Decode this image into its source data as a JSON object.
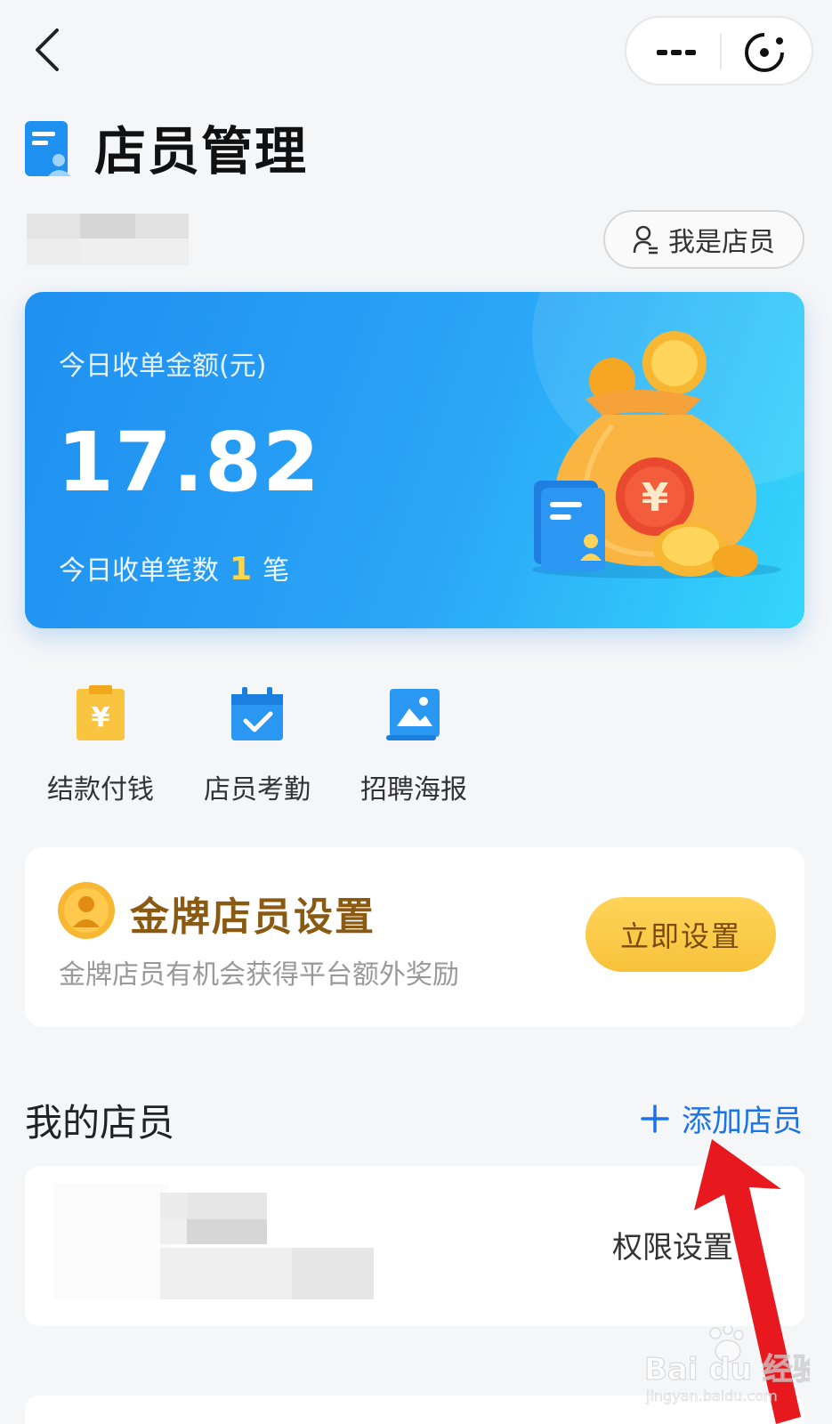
{
  "header": {
    "back_icon": "chevron-left-icon",
    "more_icon": "more-dots-icon",
    "close_icon": "mini-program-close-icon"
  },
  "page": {
    "title": "店员管理",
    "role_button": "我是店员"
  },
  "summary_card": {
    "amount_label": "今日收单金额(元)",
    "amount": "17.82",
    "count_prefix": "今日收单笔数",
    "count": "1",
    "count_suffix": "笔"
  },
  "quick_actions": [
    {
      "label": "结款付钱",
      "icon": "payment-yuan-icon"
    },
    {
      "label": "店员考勤",
      "icon": "calendar-check-icon"
    },
    {
      "label": "招聘海报",
      "icon": "poster-image-icon"
    }
  ],
  "gold_staff": {
    "title": "金牌店员设置",
    "subtitle": "金牌店员有机会获得平台额外奖励",
    "button": "立即设置"
  },
  "my_staff": {
    "title": "我的店员",
    "add_button": "添加店员",
    "permission_label": "权限设置"
  },
  "watermark": {
    "brand": "Bai du 经验",
    "url": "jingyan.baidu.com"
  },
  "colors": {
    "card_blue": "#2aa5f7",
    "gold_button": "#f7c23a",
    "link_blue": "#1a73e8",
    "annotation_red": "#e8191e"
  }
}
